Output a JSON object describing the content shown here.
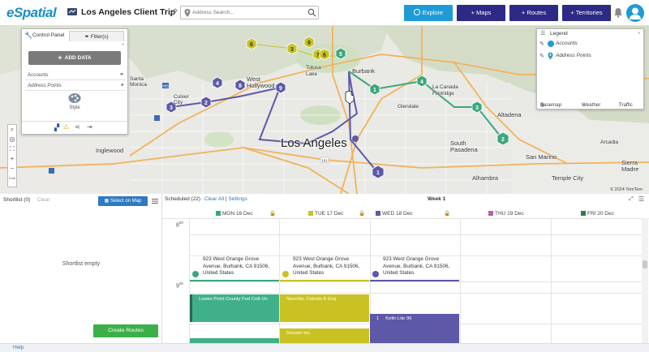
{
  "app": {
    "logo": "eSpatial"
  },
  "header": {
    "trip_title": "Los Angeles Client Trip",
    "search_placeholder": "Address Search...",
    "buttons": {
      "explore": "Explore",
      "maps": "+ Maps",
      "routes": "+ Routes",
      "territories": "+ Territories"
    }
  },
  "colors": {
    "accent": "#1e9bd7",
    "nav": "#2c2a85",
    "route": "#5d58a8",
    "green": "#3aa77a",
    "gold": "#c9c222"
  },
  "map": {
    "labels": {
      "los_angeles": "Los Angeles",
      "burbank": "Burbank",
      "inglewood": "Inglewood",
      "west_hollywood": "West Hollywood",
      "toluca_lake": "Toluca Lake",
      "la_canada": "La Canada Flintridge",
      "altadena": "Altadena",
      "south_pasadena": "South Pasadena",
      "san_marino": "San Marino",
      "alhambra": "Alhambra",
      "temple_city": "Temple City",
      "sierra_madre": "Sierra Madre",
      "culver_city": "Culver City",
      "santa_monica": "Santa Monica",
      "glendale": "Glendale",
      "arcadia": "Arcadia"
    },
    "copyright": "© 2024 TomTom",
    "scale": "3 km",
    "markers": {
      "route_blue": [
        "1",
        "2",
        "3",
        "4",
        "8",
        "9"
      ],
      "route_green": [
        "1",
        "2",
        "3",
        "4"
      ],
      "route_gold": [
        "3",
        "5",
        "6",
        "6",
        "7",
        "8",
        "9"
      ]
    }
  },
  "control_panel": {
    "tab_control": "Control Panel",
    "tab_filters": "Filter(s)",
    "add_data": "ADD DATA",
    "rows": [
      "Accounts",
      "Address Points"
    ],
    "style": "Style"
  },
  "legend": {
    "title": "Legend",
    "items": [
      "Accounts",
      "Address Points"
    ],
    "footer": {
      "basemap": "Basemap",
      "weather": "Weather",
      "traffic": "Traffic"
    }
  },
  "shortlist": {
    "title": "Shortlist (0)",
    "clear": "Clear",
    "select_on_map": "Select on Map",
    "empty": "Shortlist empty",
    "create_routes": "Create Routes"
  },
  "schedule": {
    "scheduled": "Scheduled (22)",
    "clear_all": "Clear All",
    "settings": "Settings",
    "week": "Week 1",
    "days": [
      {
        "label": "MON 16 Dec",
        "color": "#3aa77a"
      },
      {
        "label": "TUE 17 Dec",
        "color": "#c9c222"
      },
      {
        "label": "WED 18 Dec",
        "color": "#5d58a8"
      },
      {
        "label": "THU 19 Dec",
        "color": "#c05aa8"
      },
      {
        "label": "FRI 20 Dec",
        "color": "#2e7d4f"
      }
    ],
    "times": [
      "8",
      "9"
    ],
    "time_suffix": "00",
    "address": "923 West Orange Grove Avenue, Burbank, CA 91506, United States",
    "appointments": {
      "mon": "Lowes Point County Fed Crdt Un",
      "tue1": "Nierchio, Celeste K Esq",
      "tue2": "Dossier Inc",
      "wed_num": "1",
      "wed": "Kefin Lite 96"
    }
  },
  "footer": {
    "help": "Help"
  }
}
